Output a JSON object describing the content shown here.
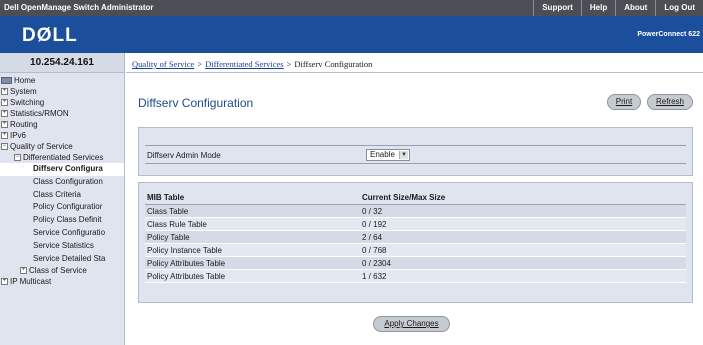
{
  "topbar": {
    "title": "Dell OpenManage Switch Administrator",
    "nav": [
      "Support",
      "Help",
      "About",
      "Log Out"
    ]
  },
  "banner": {
    "logo": "DØLL",
    "product": "PowerConnect 622"
  },
  "sidebar": {
    "ip": "10.254.24.161",
    "items": [
      {
        "label": "Home",
        "type": "folder"
      },
      {
        "label": "System",
        "type": "plus"
      },
      {
        "label": "Switching",
        "type": "plus"
      },
      {
        "label": "Statistics/RMON",
        "type": "plus"
      },
      {
        "label": "Routing",
        "type": "plus"
      },
      {
        "label": "IPv6",
        "type": "plus"
      },
      {
        "label": "Quality of Service",
        "type": "minus"
      },
      {
        "label": "Differentiated Services",
        "type": "minus"
      },
      {
        "label": "Diffserv Configura",
        "type": "leaf",
        "selected": true
      },
      {
        "label": "Class Configuration",
        "type": "leaf"
      },
      {
        "label": "Class Criteria",
        "type": "leaf"
      },
      {
        "label": "Policy Configuratior",
        "type": "leaf"
      },
      {
        "label": "Policy Class Definit",
        "type": "leaf"
      },
      {
        "label": "Service Configuratio",
        "type": "leaf"
      },
      {
        "label": "Service Statistics",
        "type": "leaf"
      },
      {
        "label": "Service Detailed Sta",
        "type": "leaf"
      },
      {
        "label": "Class of Service",
        "type": "plus"
      },
      {
        "label": "IP Multicast",
        "type": "plus"
      }
    ]
  },
  "breadcrumb": {
    "items": [
      "Quality of Service",
      "Differentiated Services"
    ],
    "current": "Diffserv Configuration",
    "separator": ">"
  },
  "page": {
    "title": "Diffserv Configuration",
    "print_label": "Print",
    "refresh_label": "Refresh",
    "apply_label": "Apply Changes"
  },
  "admin": {
    "label": "Diffserv Admin Mode",
    "value": "Enable"
  },
  "mib_table": {
    "headers": [
      "MIB Table",
      "Current Size/Max Size"
    ],
    "rows": [
      [
        "Class Table",
        "0 / 32"
      ],
      [
        "Class Rule Table",
        "0 / 192"
      ],
      [
        "Policy Table",
        "2 / 64"
      ],
      [
        "Policy Instance Table",
        "0 / 768"
      ],
      [
        "Policy Attributes Table",
        "0 / 2304"
      ],
      [
        "Policy Attributes Table",
        "1 / 632"
      ]
    ]
  },
  "colors": {
    "banner": "#1b4f9c",
    "topbar": "#4b4f55",
    "panel": "#dfe4ee",
    "title": "#1e4a8f"
  }
}
